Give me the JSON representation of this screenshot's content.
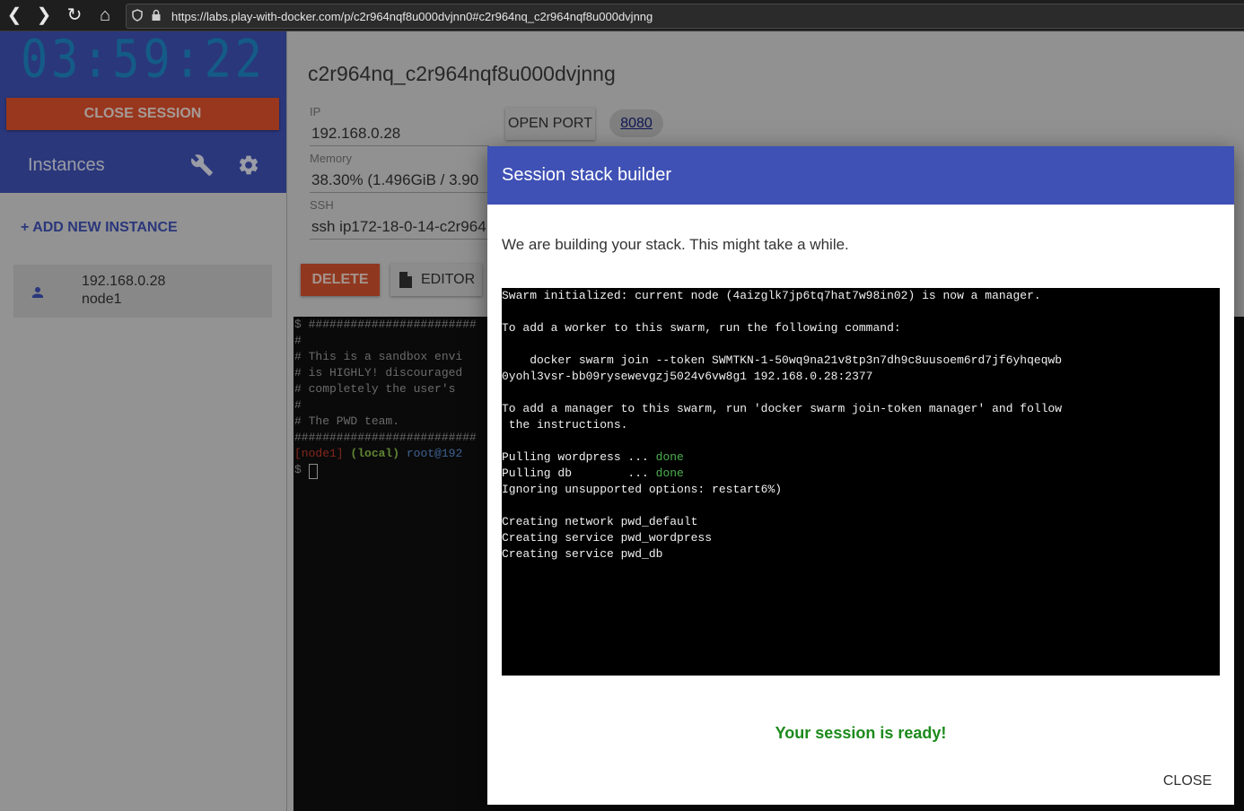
{
  "browser": {
    "back_glyph": "❮",
    "forward_glyph": "❯",
    "reload_glyph": "↻",
    "home_glyph": "⌂",
    "url": "https://labs.play-with-docker.com/p/c2r964nqf8u000dvjnn0#c2r964nq_c2r964nqf8u000dvjnng"
  },
  "sidebar": {
    "timer": "03:59:22",
    "close_session_label": "CLOSE SESSION",
    "instances_title": "Instances",
    "add_instance_label": "+ ADD NEW INSTANCE",
    "instances": [
      {
        "ip": "192.168.0.28",
        "name": "node1"
      }
    ]
  },
  "instance": {
    "title": "c2r964nq_c2r964nqf8u000dvjnng",
    "ip_label": "IP",
    "ip_value": "192.168.0.28",
    "memory_label": "Memory",
    "memory_value": "38.30% (1.496GiB / 3.90",
    "ssh_label": "SSH",
    "ssh_value": "ssh ip172-18-0-14-c2r964",
    "open_port_label": "OPEN PORT",
    "port": "8080",
    "delete_label": "DELETE",
    "editor_label": "EDITOR"
  },
  "terminal": {
    "lines": [
      "$ ########################",
      "#",
      "# This is a sandbox envi",
      "# is HIGHLY! discouraged",
      "# completely the user's",
      "#",
      "# The PWD team.",
      "##########################"
    ],
    "prompt_node": "[node1]",
    "prompt_local": "(local)",
    "prompt_user": "root@192",
    "prompt_dollar": "$"
  },
  "modal": {
    "title": "Session stack builder",
    "message": "We are building your stack. This might take a while.",
    "log": [
      "Swarm initialized: current node (4aizglk7jp6tq7hat7w98in02) is now a manager.",
      "",
      "To add a worker to this swarm, run the following command:",
      "",
      "    docker swarm join --token SWMTKN-1-50wq9na21v8tp3n7dh9c8uusoem6rd7jf6yhqeqwb",
      "0yohl3vsr-bb09rysewevgzj5024v6vw8g1 192.168.0.28:2377",
      "",
      "To add a manager to this swarm, run 'docker swarm join-token manager' and follow",
      " the instructions.",
      ""
    ],
    "pull_wordpress": "Pulling wordpress ... ",
    "pull_db": "Pulling db        ... ",
    "done_label": "done",
    "log_tail": [
      "Ignoring unsupported options: restart6%)",
      "",
      "Creating network pwd_default",
      "Creating service pwd_wordpress",
      "Creating service pwd_db"
    ],
    "ready_message": "Your session is ready!",
    "close_label": "CLOSE"
  },
  "colors": {
    "primary": "#3f51b5",
    "danger": "#e0522c",
    "success": "#1b8a1b"
  }
}
